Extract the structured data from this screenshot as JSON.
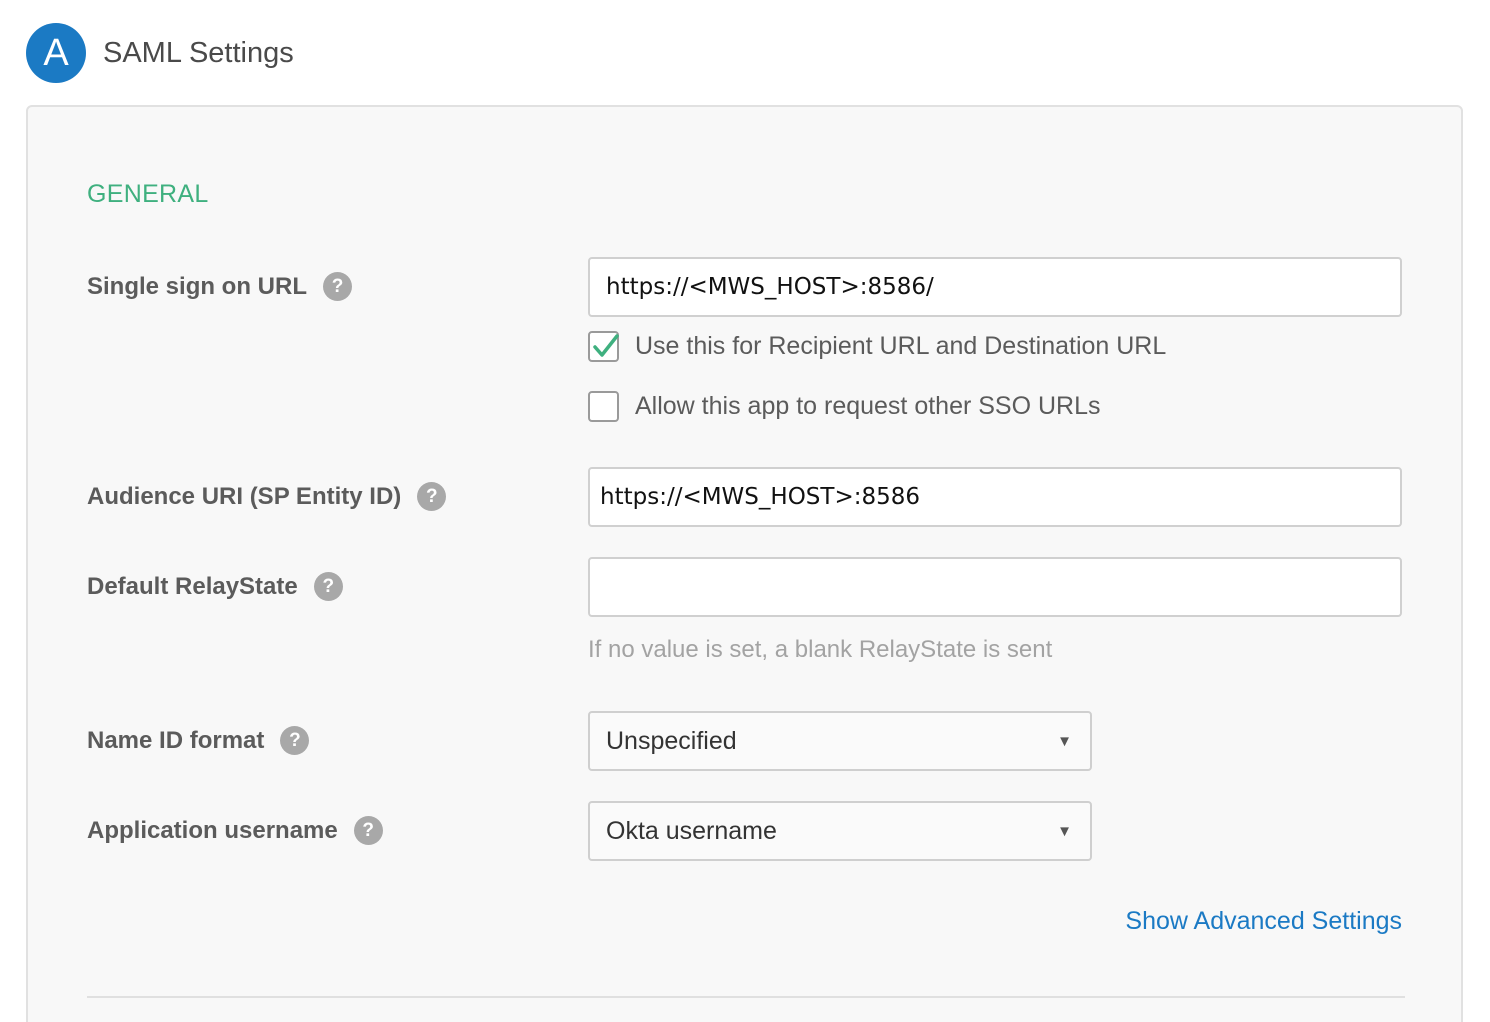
{
  "header": {
    "step_letter": "A",
    "title": "SAML Settings"
  },
  "section": {
    "title": "GENERAL"
  },
  "fields": {
    "sso_url": {
      "label": "Single sign on URL",
      "value": "https://<MWS_HOST>:8586/"
    },
    "use_recipient": {
      "label": "Use this for Recipient URL and Destination URL",
      "checked": true
    },
    "allow_other_sso": {
      "label": "Allow this app to request other SSO URLs",
      "checked": false
    },
    "audience_uri": {
      "label": "Audience URI (SP Entity ID)",
      "value": "https://<MWS_HOST>:8586"
    },
    "relay_state": {
      "label": "Default RelayState",
      "value": "",
      "hint": "If no value is set, a blank RelayState is sent"
    },
    "name_id_format": {
      "label": "Name ID format",
      "value": "Unspecified"
    },
    "app_username": {
      "label": "Application username",
      "value": "Okta username"
    }
  },
  "help_icon_glyph": "?",
  "select_arrow_glyph": "▼",
  "advanced_link": "Show Advanced Settings",
  "colors": {
    "accent_blue": "#1b7ac4",
    "section_green": "#3fb07f",
    "check_green": "#3fb07f"
  }
}
